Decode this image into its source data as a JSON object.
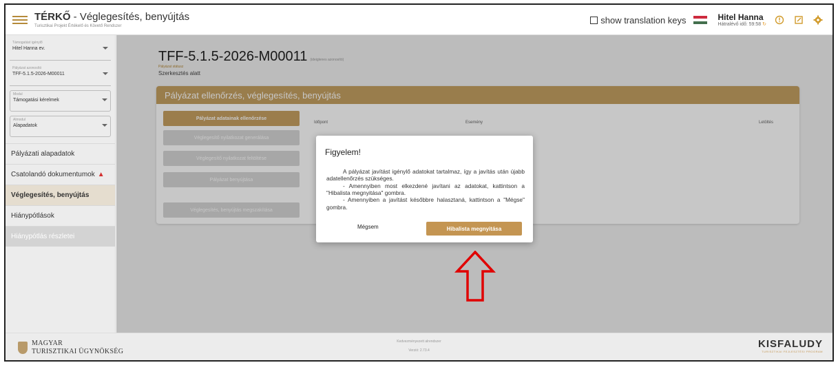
{
  "header": {
    "title": "TÉRKŐ",
    "subtitle_page": " - Véglegesítés, benyújtás",
    "system_name": "Turisztikai Projekt Értékelő és Követő Rendszer",
    "show_translation_keys": "show translation keys",
    "user_name": "Hitel Hanna",
    "remaining_time": "Hátralévő idő: 59:58"
  },
  "sidebar": {
    "selects": [
      {
        "label": "Támogatást igénylő",
        "value": "Hitel Hanna ev."
      },
      {
        "label": "Pályázat azonosító",
        "value": "TFF-5.1.5-2026-M00011"
      },
      {
        "label": "Modul",
        "value": "Támogatási kérelmek"
      },
      {
        "label": "Almodul",
        "value": "Alapadatok"
      }
    ],
    "nav": [
      {
        "label": "Pályázati alapadatok"
      },
      {
        "label": "Csatolandó dokumentumok"
      },
      {
        "label": "Véglegesítés, benyújtás"
      },
      {
        "label": "Hiánypótlások"
      },
      {
        "label": "Hiánypótlás részletei"
      }
    ]
  },
  "main": {
    "application_code": "TFF-5.1.5-2026-M00011",
    "code_note": "(ideiglenes azonosító)",
    "status_label": "Pályázat státusz",
    "status_value": "Szerkesztés alatt",
    "panel_title": "Pályázat ellenőrzés, véglegesítés, benyújtás",
    "buttons": [
      "Pályázat adatainak ellenőrzése",
      "Véglegesítő nyilatkozat generálása",
      "Véglegesítő nyilatkozat feltöltése",
      "Pályázat benyújtása",
      "Véglegesítés, benyújtás megszakítása"
    ],
    "table_headers": [
      "Időpont",
      "Esemény",
      "Letöltés"
    ]
  },
  "modal": {
    "title": "Figyelem!",
    "line1": "A pályázat javítást igénylő adatokat tartalmaz, így a javítás után újabb adatellenőrzés szükséges.",
    "line2": "- Amennyiben most elkezdené javítani az adatokat, kattintson a \"Hibalista megnyitása\" gombra.",
    "line3": "- Amennyiben a javítást későbbre halasztaná, kattintson a \"Mégse\" gombra.",
    "cancel": "Mégsem",
    "confirm": "Hibalista megnyitása"
  },
  "footer": {
    "logo_line1": "MAGYAR",
    "logo_line2": "TURISZTIKAI ÜGYNÖKSÉG",
    "center_line1": "Kedvezményezett alrendszer",
    "center_line2": "Verzió: 2.73.4",
    "right_logo": "KISFALUDY",
    "right_sub": "TURISZTIKAI FEJLESZTÉSI PROGRAM"
  },
  "colors": {
    "accent": "#c49552",
    "warning": "#d32f2f",
    "annotation_arrow": "#e00000"
  }
}
